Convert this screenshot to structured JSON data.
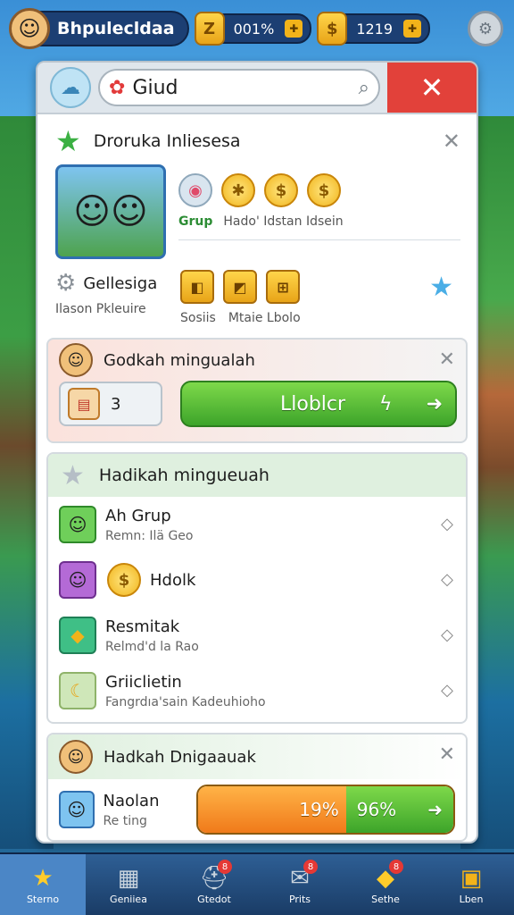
{
  "player": {
    "name": "Bhpulecldaa"
  },
  "resources": [
    {
      "icon": "gold-bar-icon",
      "glyph": "Z",
      "value": "001%"
    },
    {
      "icon": "coin-stack-icon",
      "glyph": "$",
      "value": "1219"
    }
  ],
  "search": {
    "value": "Giud"
  },
  "section1": {
    "title": "Droruka Inliesesa",
    "items_labels": [
      "Grup",
      "Hado' Idstan Idsein"
    ],
    "gear_title": "Gellesiga",
    "gear_subtitle": "Ilason Pkleuire",
    "foot_labels": [
      "Sosiis",
      "Mtaie Lbolo"
    ]
  },
  "card2": {
    "title": "Godkah mingualah",
    "quantity": "3",
    "button_label": "Lloblcr",
    "button_glyph": "ϟ"
  },
  "card3": {
    "title": "Hadikah mingueuah",
    "items": [
      {
        "title": "Ah Grup",
        "subtitle": "Remn: Ilä Geo",
        "icon": "hero-avatar-icon"
      },
      {
        "title": "Hdolk",
        "subtitle": "",
        "icon": "coin-icon"
      },
      {
        "title": "Resmitak",
        "subtitle": "Relmd'd la Rao",
        "icon": "gold-bar-icon"
      },
      {
        "title": "Griiclietin",
        "subtitle": "Fangrdıa'sain Kadeuhioho",
        "icon": "banana-icon"
      }
    ]
  },
  "card4": {
    "title": "Hadkah Dnigaauak",
    "item_title": "Naolan",
    "item_subtitle": "Re ting",
    "progress_left": "19%",
    "progress_right": "96%"
  },
  "nav": [
    {
      "label": "Sterno",
      "icon": "star-icon",
      "badge": ""
    },
    {
      "label": "Geniiea",
      "icon": "calendar-icon",
      "badge": ""
    },
    {
      "label": "Gtedot",
      "icon": "helmet-icon",
      "badge": "8"
    },
    {
      "label": "Prits",
      "icon": "chat-icon",
      "badge": "8"
    },
    {
      "label": "Sethe",
      "icon": "gold-pile-icon",
      "badge": "8"
    },
    {
      "label": "Lben",
      "icon": "chest-icon",
      "badge": ""
    }
  ]
}
